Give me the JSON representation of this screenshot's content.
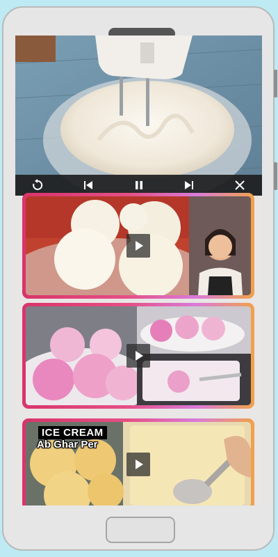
{
  "video_player": {
    "controls": [
      {
        "name": "replay-icon"
      },
      {
        "name": "skip-previous-icon"
      },
      {
        "name": "pause-icon"
      },
      {
        "name": "skip-next-icon"
      },
      {
        "name": "close-icon"
      }
    ]
  },
  "video_list": [
    {
      "thumbnail": "vanilla-ice-cream-scoops",
      "title_overlay": "",
      "subtitle_overlay": ""
    },
    {
      "thumbnail": "pink-ice-cream-scoops",
      "title_overlay": "",
      "subtitle_overlay": ""
    },
    {
      "thumbnail": "mango-ice-cream-tray",
      "title_overlay": "ICE CREAM",
      "subtitle_overlay": "Ab Ghar Per"
    }
  ],
  "colors": {
    "background": "#bdeaf3",
    "card_gradient": [
      "#d9346b",
      "#e54f85",
      "#d97bd9",
      "#f1a24a"
    ],
    "controls_bar": "#1e1e1e"
  }
}
